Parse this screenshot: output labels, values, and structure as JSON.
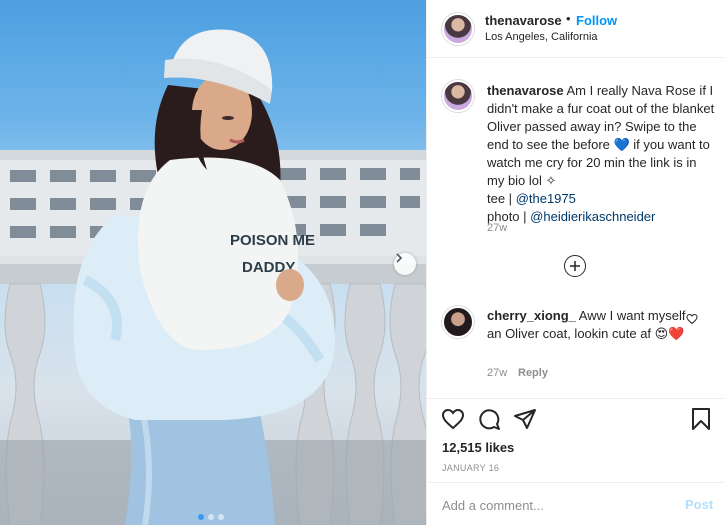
{
  "photo": {
    "shirt_text_line1": "POISON ME",
    "shirt_text_line2": "DADDY",
    "carousel_dots": 3,
    "active_dot": 1
  },
  "header": {
    "username": "thenavarose",
    "separator": "•",
    "follow_label": "Follow",
    "location": "Los Angeles, California"
  },
  "caption": {
    "username": "thenavarose",
    "text_before_heart": "Am I really Nava Rose if I didn't make a fur coat out of the blanket Oliver passed away in? Swipe to the end to see the before ",
    "heart": "💙",
    "text_after_heart": " if you want to watch me cry for 20 min the link is in my bio lol ✧",
    "tee_label": "tee |",
    "tee_link": "@the1975",
    "photo_label": "photo |",
    "photo_link": "@heidierikaschneider",
    "time": "27w"
  },
  "comment": {
    "username": "cherry_xiong_",
    "text": "Aww I want myself an Oliver coat, lookin cute af",
    "emojis": "😍❤️",
    "time": "27w",
    "reply_label": "Reply"
  },
  "actions": {
    "icons": [
      "heart-icon",
      "comment-icon",
      "share-icon",
      "bookmark-icon"
    ]
  },
  "likes": "12,515 likes",
  "date": "JANUARY 16",
  "add_comment": {
    "placeholder": "Add a comment...",
    "post_label": "Post"
  },
  "colors": {
    "follow": "#0095f6",
    "link": "#00376b",
    "muted": "#8e8e8e",
    "post_disabled": "#b2dffc",
    "active_dot": "#3897f0"
  }
}
